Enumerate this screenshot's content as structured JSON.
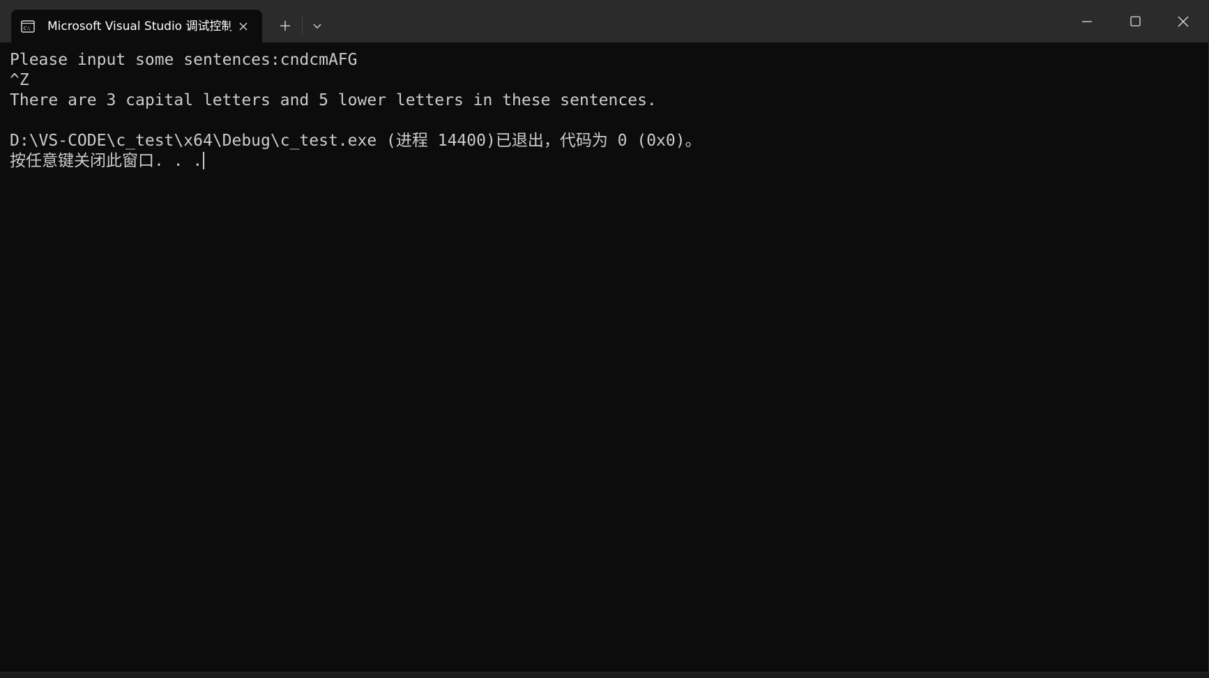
{
  "window": {
    "tab_title": "Microsoft Visual Studio 调试控制台",
    "tab_icon": "console-icon"
  },
  "titlebar_controls": {
    "new_tab_icon": "plus-icon",
    "dropdown_icon": "chevron-down-icon",
    "minimize_icon": "minimize-icon",
    "maximize_icon": "maximize-icon",
    "close_icon": "close-icon"
  },
  "console": {
    "lines": [
      "Please input some sentences:cndcmAFG",
      "^Z",
      "There are 3 capital letters and 5 lower letters in these sentences.",
      "",
      "D:\\VS-CODE\\c_test\\x64\\Debug\\c_test.exe (进程 14400)已退出，代码为 0 (0x0)。",
      "按任意键关闭此窗口. . ."
    ]
  },
  "colors": {
    "terminal_background": "#0c0c0c",
    "titlebar_background": "#2b2b2b",
    "text": "#cccccc"
  }
}
